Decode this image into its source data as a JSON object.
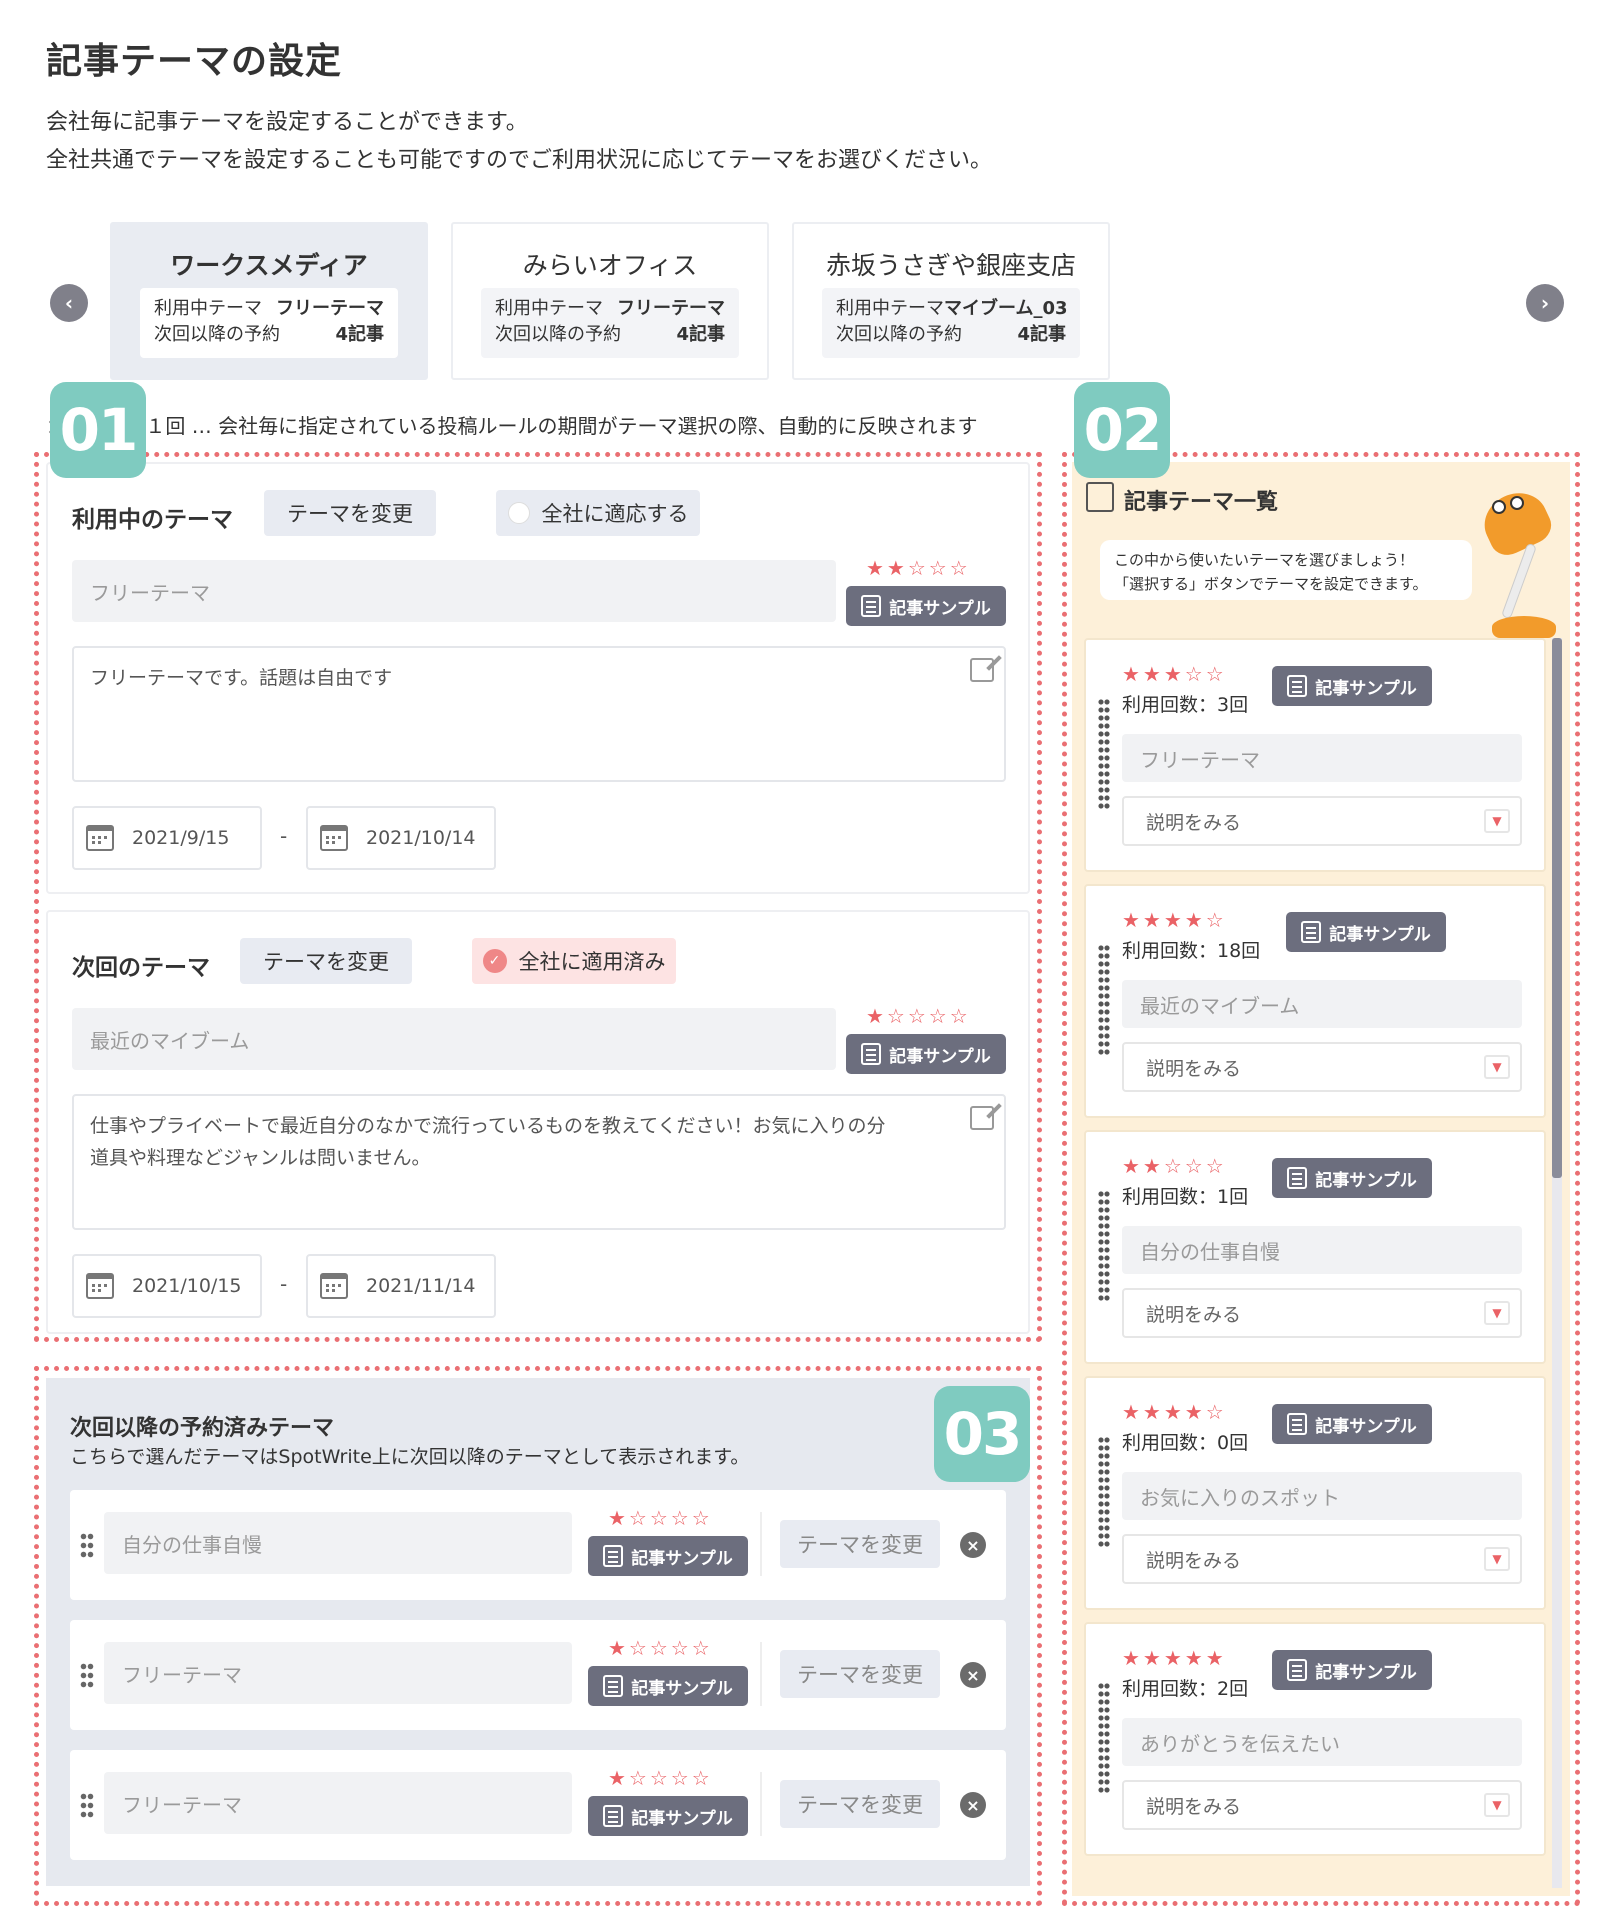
{
  "page": {
    "title": "記事テーマの設定",
    "desc_line1": "会社毎に記事テーマを設定することができます。",
    "desc_line2": "全社共通でテーマを設定することも可能ですのでご利用状況に応じてテーマをお選びください。"
  },
  "companies": [
    {
      "name": "ワークスメディア",
      "using_label": "利用中テーマ",
      "using_value": "フリーテーマ",
      "reserve_label": "次回以降の予約",
      "reserve_value": "4記事"
    },
    {
      "name": "みらいオフィス",
      "using_label": "利用中テーマ",
      "using_value": "フリーテーマ",
      "reserve_label": "次回以降の予約",
      "reserve_value": "4記事"
    },
    {
      "name": "赤坂うさぎや銀座支店",
      "using_label": "利用中テーマ",
      "using_value": "マイブーム_03",
      "reserve_label": "次回以降の予約",
      "reserve_value": "4記事"
    }
  ],
  "rule_text": "：ひと月に１回 … 会社毎に指定されている投稿ルールの期間がテーマ選択の際、自動的に反映されます",
  "badges": {
    "b1": "01",
    "b2": "02",
    "b3": "03"
  },
  "current_theme": {
    "title": "利用中のテーマ",
    "change_label": "テーマを変更",
    "apply_all_label": "全社に適応する",
    "name": "フリーテーマ",
    "stars": "★★☆☆☆",
    "sample_label": "記事サンプル",
    "description": "フリーテーマです。話題は自由です",
    "date_start": "2021/9/15",
    "date_end": "2021/10/14",
    "date_sep": "-"
  },
  "next_theme": {
    "title": "次回のテーマ",
    "change_label": "テーマを変更",
    "applied_label": "全社に適用済み",
    "name": "最近のマイブーム",
    "stars": "★☆☆☆☆",
    "sample_label": "記事サンプル",
    "description_line1": "仕事やプライベートで最近自分のなかで流行っているものを教えてください！お気に入りの分",
    "description_line2": "道具や料理などジャンルは問いません。",
    "date_start": "2021/10/15",
    "date_end": "2021/11/14",
    "date_sep": "-"
  },
  "reserved": {
    "title": "次回以降の予約済みテーマ",
    "subtitle": "こちらで選んだテーマはSpotWrite上に次回以降のテーマとして表示されます。",
    "rows": [
      {
        "name": "自分の仕事自慢",
        "stars": "★☆☆☆☆",
        "sample_label": "記事サンプル",
        "change_label": "テーマを変更"
      },
      {
        "name": "フリーテーマ",
        "stars": "★☆☆☆☆",
        "sample_label": "記事サンプル",
        "change_label": "テーマを変更"
      },
      {
        "name": "フリーテーマ",
        "stars": "★☆☆☆☆",
        "sample_label": "記事サンプル",
        "change_label": "テーマを変更"
      }
    ]
  },
  "theme_list": {
    "title": "記事テーマ一覧",
    "hint_line1": "この中から使いたいテーマを選びましょう！",
    "hint_line2": "「選択する」ボタンでテーマを設定できます。",
    "items": [
      {
        "stars": "★★★☆☆",
        "usage": "利用回数：3回",
        "name": "フリーテーマ",
        "detail": "説明をみる",
        "sample_label": "記事サンプル"
      },
      {
        "stars": "★★★★☆",
        "usage": "利用回数：18回",
        "name": "最近のマイブーム",
        "detail": "説明をみる",
        "sample_label": "記事サンプル"
      },
      {
        "stars": "★★☆☆☆",
        "usage": "利用回数：1回",
        "name": "自分の仕事自慢",
        "detail": "説明をみる",
        "sample_label": "記事サンプル"
      },
      {
        "stars": "★★★★☆",
        "usage": "利用回数：0回",
        "name": "お気に入りのスポット",
        "detail": "説明をみる",
        "sample_label": "記事サンプル"
      },
      {
        "stars": "★★★★★",
        "usage": "利用回数：2回",
        "name": "ありがとうを伝えたい",
        "detail": "説明をみる",
        "sample_label": "記事サンプル"
      }
    ]
  },
  "icons": {
    "prev": "chevron-left-icon",
    "next": "chevron-right-icon",
    "edit": "edit-icon",
    "calendar": "calendar-icon",
    "close": "close-icon",
    "grip": "drag-handle-icon",
    "memo": "memo-icon",
    "lamp": "lamp-mascot"
  },
  "colors": {
    "accent_red": "#ea6f73",
    "badge_teal": "#7fcbc0",
    "sample_btn": "#6c6e7e",
    "list_bg": "#fdf0d9",
    "reserved_bg": "#e6e9ef"
  }
}
